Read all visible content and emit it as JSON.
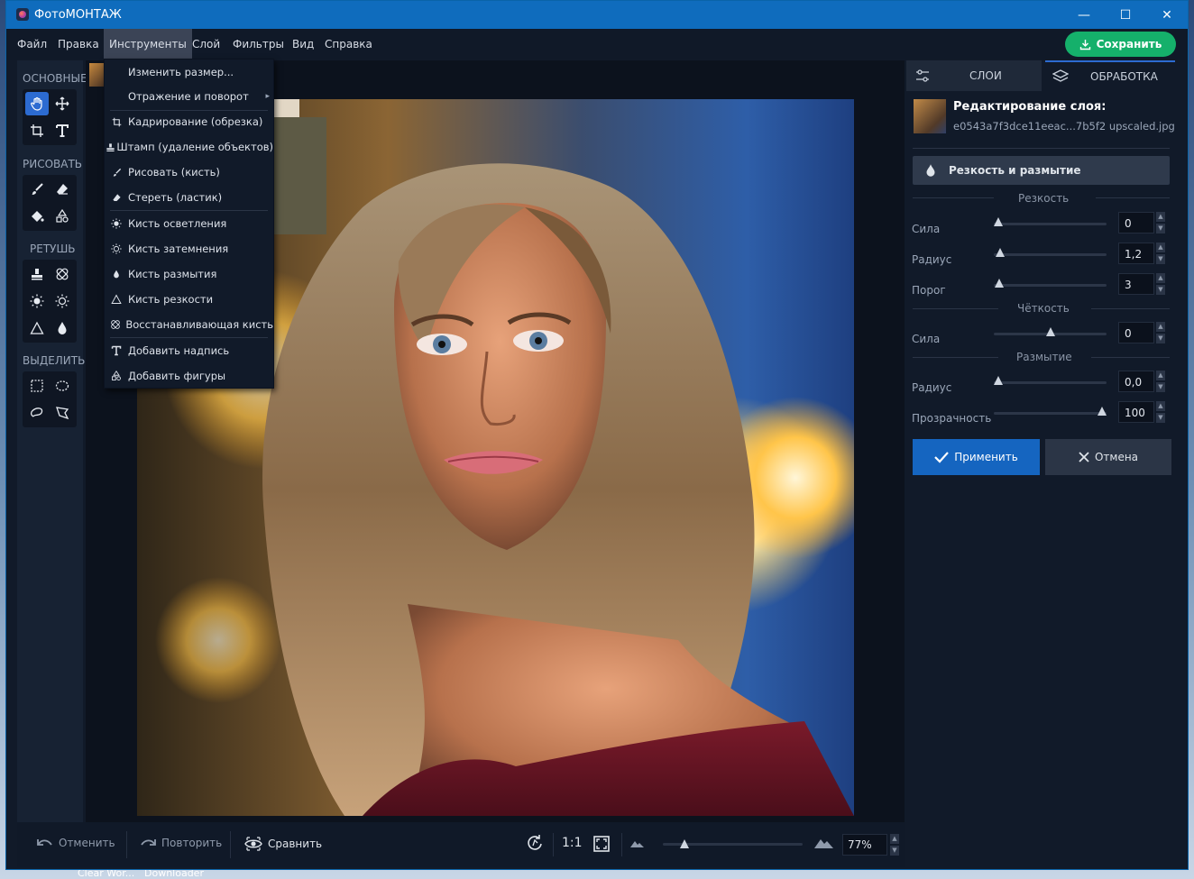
{
  "window": {
    "title": "ФотоМОНТАЖ"
  },
  "menu": [
    "Файл",
    "Правка",
    "Инструменты",
    "Слой",
    "Фильтры",
    "Вид",
    "Справка"
  ],
  "save_label": "Сохранить",
  "toolbar": {
    "sections": [
      "ОСНОВНЫЕ",
      "РИСОВАТЬ",
      "РЕТУШЬ",
      "ВЫДЕЛИТЬ"
    ]
  },
  "dropdown": [
    "Изменить размер...",
    "Отражение и поворот",
    "Кадрирование (обрезка)",
    "Штамп (удаление объектов)",
    "Рисовать (кисть)",
    "Стереть (ластик)",
    "Кисть осветления",
    "Кисть затемнения",
    "Кисть размытия",
    "Кисть резкости",
    "Восстанавливающая кисть",
    "Добавить надпись",
    "Добавить фигуры"
  ],
  "bottom": {
    "undo": "Отменить",
    "redo": "Повторить",
    "compare": "Сравнить",
    "one_to_one": "1:1",
    "zoom": "77%",
    "zoom_level": 0.77
  },
  "right": {
    "tabs": [
      "СЛОИ",
      "ОБРАБОТКА"
    ],
    "layer_title": "Редактирование слоя:",
    "layer_file": "e0543a7f3dce11eeac...7b5f2 upscaled.jpg",
    "panel_title": "Резкость и размытие",
    "sections": {
      "sharpness": "Резкость",
      "clarity": "Чёткость",
      "blur": "Размытие"
    },
    "sliders": [
      {
        "label": "Сила",
        "value": "0",
        "level": 0.0
      },
      {
        "label": "Радиус",
        "value": "1,2",
        "level": 0.02
      },
      {
        "label": "Порог",
        "value": "3",
        "level": 0.01
      },
      {
        "label": "Сила",
        "value": "0",
        "level": 0.5
      },
      {
        "label": "Радиус",
        "value": "0,0",
        "level": 0.0
      },
      {
        "label": "Прозрачность",
        "value": "100",
        "level": 1.0
      }
    ],
    "apply": "Применить",
    "cancel": "Отмена"
  },
  "taskbar": [
    "Clear Wor...",
    "Downloader"
  ]
}
